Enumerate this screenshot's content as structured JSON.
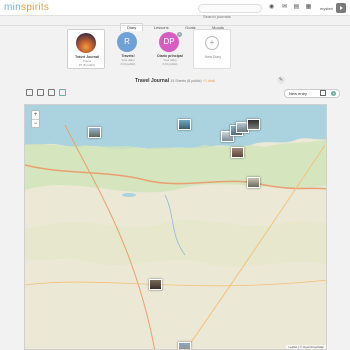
{
  "brand": {
    "min": "min",
    "spirits": "spirits"
  },
  "search": {
    "placeholder": "Search journals"
  },
  "user": {
    "name": "mysteri"
  },
  "tabs": [
    {
      "label": "Diary"
    },
    {
      "label": "Lessons"
    },
    {
      "label": "Goals"
    },
    {
      "label": "Moods"
    }
  ],
  "diaries": [
    {
      "title": "Travel Journal",
      "subtitle": "Travel",
      "count": "15 (8 public)"
    },
    {
      "initial": "R",
      "title": "Travels!",
      "subtitle": "Your diary",
      "count": "0 (0 public)"
    },
    {
      "initial": "DP",
      "title": "Diario principal",
      "subtitle": "Your diary",
      "count": "0 (0 public)",
      "badge": "2"
    },
    {
      "title": "New Diary"
    }
  ],
  "journal": {
    "title": "Travel Journal",
    "meta": "15 Sheets (8 public)",
    "draft": "+1 draft"
  },
  "toolbar": {
    "new_entry": "New entry"
  },
  "map": {
    "zoom_in": "+",
    "zoom_out": "−",
    "attribution": "Leaflet | © OpenStreetMap"
  },
  "colors": {
    "accent": "#6cb0a0",
    "brand_blue": "#7fb0c8",
    "brand_orange": "#e9a23b",
    "sea": "#aad3df",
    "land": "#e8e6d8",
    "r_avatar": "#6fa0d6",
    "dp_avatar": "#d65ec0"
  }
}
